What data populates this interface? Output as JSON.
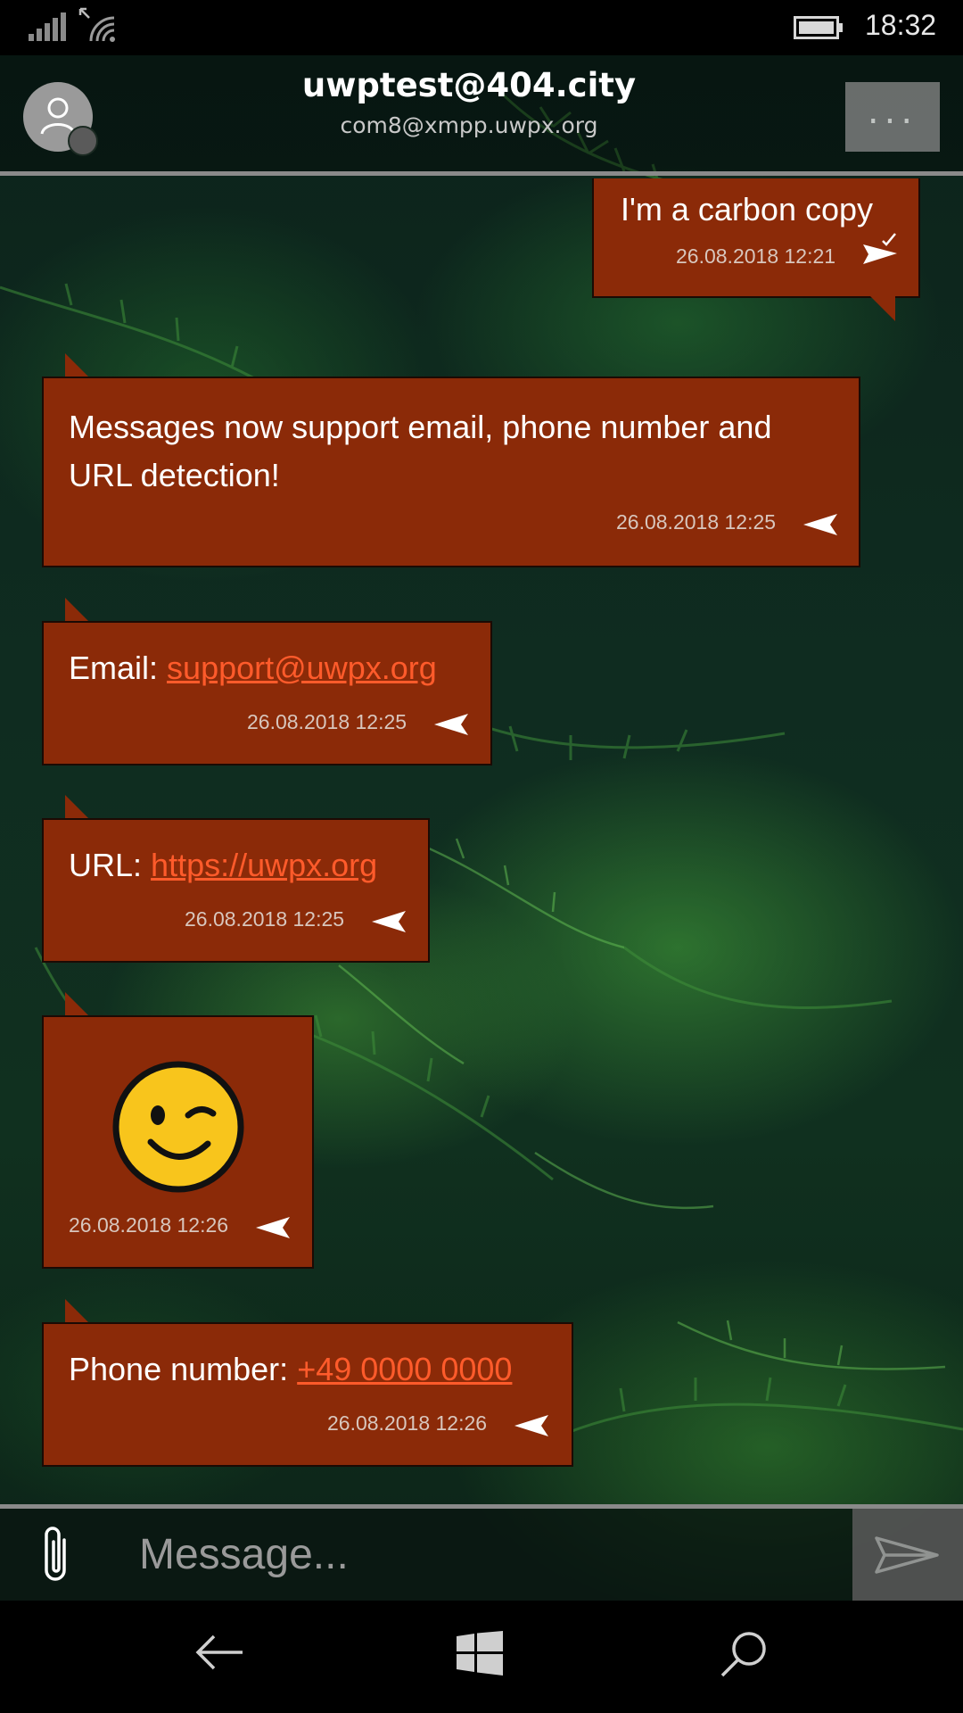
{
  "status_bar": {
    "time": "18:32",
    "icons": [
      "signal-icon",
      "wifi-icon",
      "battery-icon"
    ]
  },
  "header": {
    "title": "uwptest@404.city",
    "subtitle": "com8@xmpp.uwpx.org",
    "more_label": "...",
    "icons": [
      "avatar-icon",
      "more-icon"
    ]
  },
  "messages": [
    {
      "direction": "outgoing",
      "text": "I'm a carbon copy",
      "timestamp": "26.08.2018 12:21",
      "status_icon": "delivered-icon"
    },
    {
      "direction": "incoming",
      "text": "Messages now support email, phone number and URL detection!",
      "timestamp": "26.08.2018 12:25",
      "status_icon": "received-icon"
    },
    {
      "direction": "incoming",
      "label": "Email:",
      "link": "support@uwpx.org",
      "timestamp": "26.08.2018 12:25",
      "status_icon": "received-icon"
    },
    {
      "direction": "incoming",
      "label": "URL:",
      "link": "https://uwpx.org",
      "timestamp": "26.08.2018 12:25",
      "status_icon": "received-icon"
    },
    {
      "direction": "incoming",
      "emoji": "winking-face-emoji",
      "timestamp": "26.08.2018 12:26",
      "status_icon": "received-icon"
    },
    {
      "direction": "incoming",
      "label": "Phone number:",
      "link": "+49 0000 0000",
      "timestamp": "26.08.2018 12:26",
      "status_icon": "received-icon"
    }
  ],
  "composer": {
    "placeholder": "Message...",
    "icons": [
      "attach-icon",
      "send-icon"
    ]
  },
  "nav_bar": {
    "icons": [
      "back-icon",
      "windows-icon",
      "search-icon"
    ]
  },
  "colors": {
    "bubble": "#8b2a08",
    "link": "#ff5b2b",
    "header_line": "#8a8a8a"
  }
}
